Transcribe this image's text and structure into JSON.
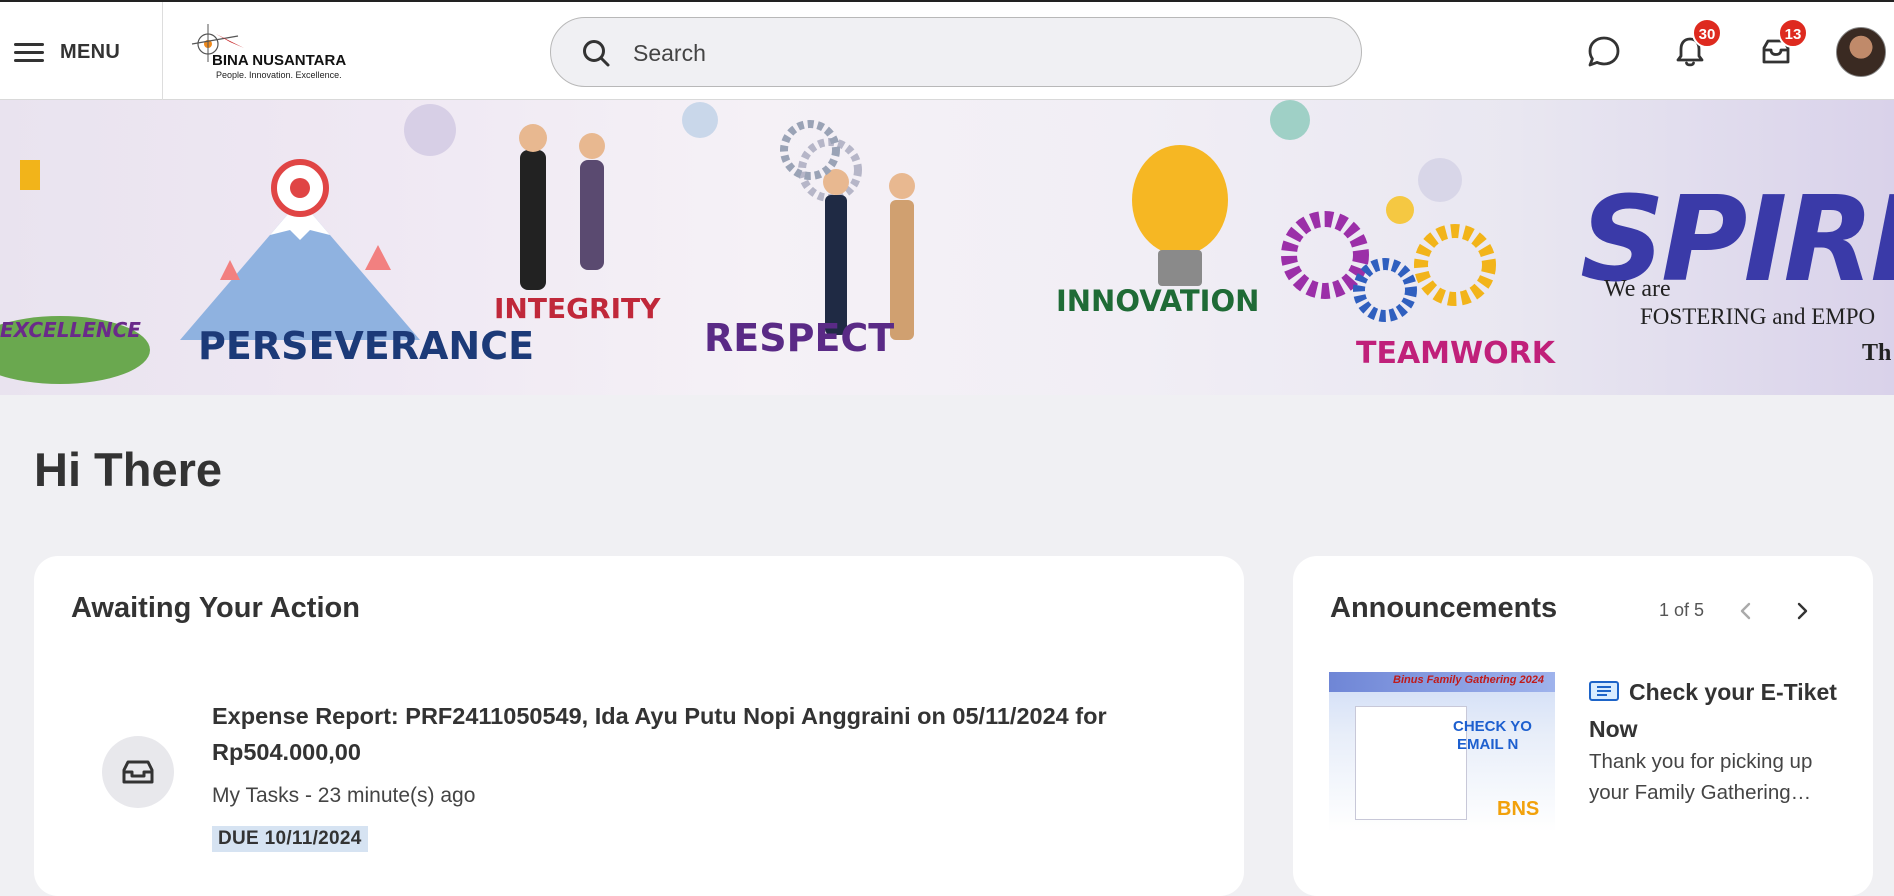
{
  "topbar": {
    "menu_label": "MENU",
    "logo": {
      "name": "BINA NUSANTARA",
      "tagline": "People.  Innovation.  Excellence."
    },
    "search": {
      "placeholder": "Search",
      "value": ""
    },
    "icons": [
      "chat-icon",
      "bell-icon",
      "inbox-icon"
    ],
    "notifications_count": "30",
    "inbox_count": "13"
  },
  "banner": {
    "values": [
      "EXCELLENCE",
      "PERSEVERANCE",
      "INTEGRITY",
      "RESPECT",
      "INNOVATION",
      "TEAMWORK"
    ],
    "spirit": "SPIRI",
    "tagline_1": "We are",
    "tagline_2": "FOSTERING and EMPO",
    "tagline_3": "Th"
  },
  "greeting": "Hi There",
  "awaiting": {
    "title": "Awaiting Your Action",
    "task": {
      "title": "Expense Report: PRF2411050549, Ida Ayu Putu Nopi Anggraini on 05/11/2024 for Rp504.000,00",
      "meta": "My Tasks - 23 minute(s) ago",
      "due": "DUE 10/11/2024",
      "icon": "inbox-tray-icon"
    }
  },
  "announcements": {
    "title": "Announcements",
    "pager": "1 of 5",
    "item": {
      "title": "Check your E-Tiket Now",
      "body": "Thank you for picking up your Family Gathering ticket",
      "thumb_title": "Binus Family Gathering 2024",
      "thumb_line_1": "CHECK YO",
      "thumb_line_2": "EMAIL N",
      "thumb_brand": "BNS"
    }
  },
  "colors": {
    "badge": "#de2a1f",
    "due_bg": "#d6e3f2",
    "page_bg": "#f0f0f3"
  }
}
